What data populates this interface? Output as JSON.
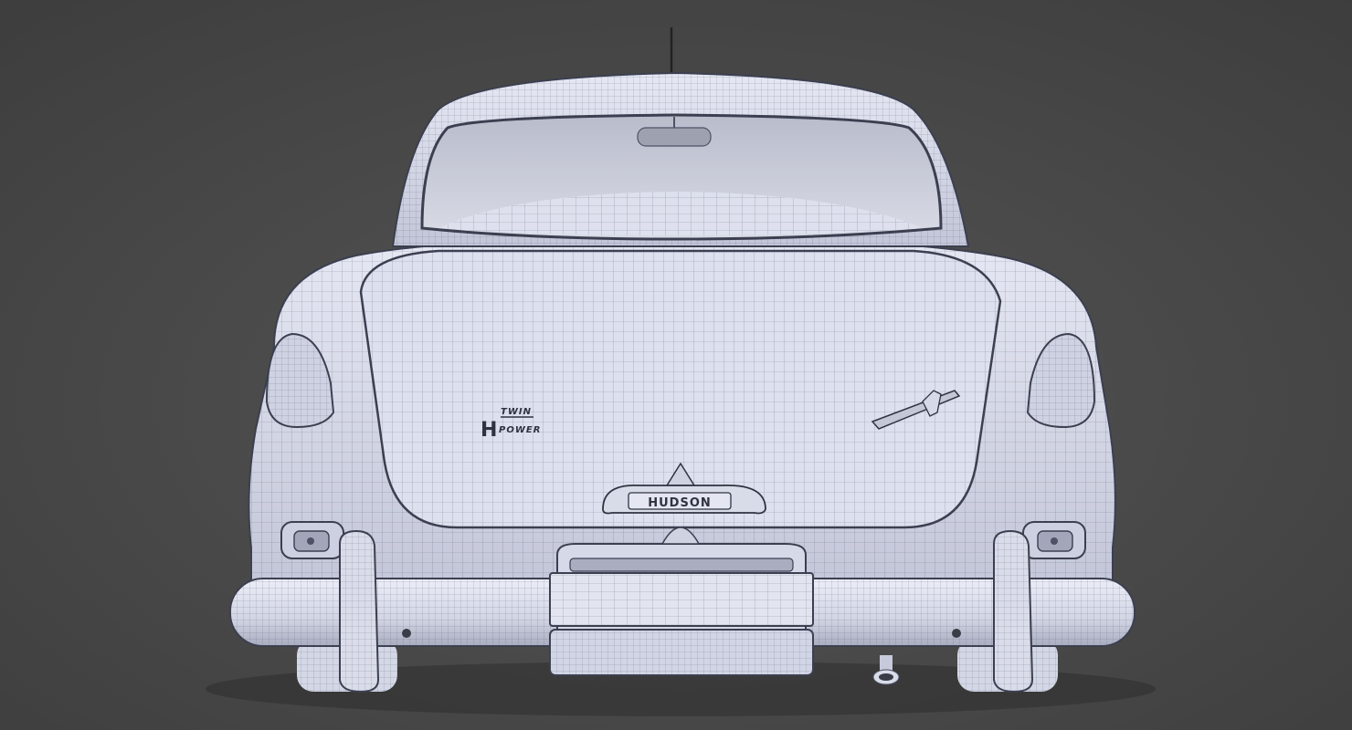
{
  "scene": {
    "subject": "car-rear-wireframe",
    "colors": {
      "background": "#4a4a4a",
      "body": "#d9dcee",
      "body_shade": "#aeb2c6",
      "wire": "#4d5266",
      "glass": "#c9ccd8",
      "dark": "#34373f"
    }
  },
  "emblems": {
    "twin": "TWIN",
    "power": "POWER",
    "twin_h_letter": "H",
    "brand_plate": "HUDSON"
  }
}
